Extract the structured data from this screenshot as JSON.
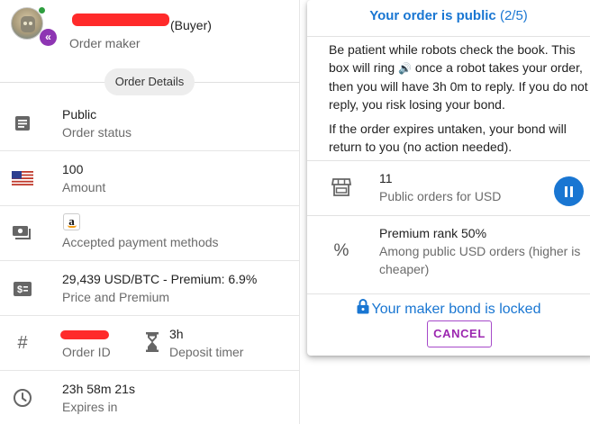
{
  "maker": {
    "buyer_tag": "(Buyer)",
    "role": "Order maker",
    "icon_avatar": "robot-avatar",
    "icon_back": "chevron-left-badge-icon",
    "online_color": "#2e9e3f"
  },
  "details_chip": "Order Details",
  "details": {
    "status": {
      "primary": "Public",
      "secondary": "Order status",
      "icon": "article-icon"
    },
    "amount": {
      "primary": "100",
      "secondary": "Amount",
      "icon": "us-flag-icon"
    },
    "payment": {
      "secondary": "Accepted payment methods",
      "icon": "payments-icon",
      "method_icon": "amazon-icon"
    },
    "price": {
      "primary": "29,439 USD/BTC - Premium: 6.9%",
      "secondary": "Price and Premium",
      "icon": "price-change-icon"
    },
    "order_id": {
      "secondary": "Order ID",
      "icon": "hash-icon"
    },
    "deposit_timer": {
      "primary": "3h",
      "secondary": "Deposit timer",
      "icon": "hourglass-icon"
    },
    "expires": {
      "primary": "23h 58m 21s",
      "secondary": "Expires in",
      "icon": "clock-icon"
    }
  },
  "card": {
    "title": "Your order is public",
    "step": "(2/5)",
    "para1_a": "Be patient while robots check the book. This box will ring",
    "para1_b": "once a robot takes your order, then you will have 3h 0m to reply. If you do not reply, you risk losing your bond.",
    "para2": "If the order expires untaken, your bond will return to you (no action needed).",
    "public_orders": {
      "primary": "11",
      "secondary": "Public orders for USD",
      "icon": "storefront-icon"
    },
    "premium_rank": {
      "primary": "Premium rank 50%",
      "secondary": "Among public USD orders (higher is cheaper)",
      "icon": "percent-icon"
    },
    "bond": "Your maker bond is locked",
    "cancel": "CANCEL",
    "icon_bell": "bell-speaker-icon",
    "icon_pause": "pause-icon",
    "icon_lock": "lock-icon"
  },
  "colors": {
    "accent": "#1976d2",
    "cancel": "#9c27b0",
    "back_badge": "#8e35b3"
  }
}
